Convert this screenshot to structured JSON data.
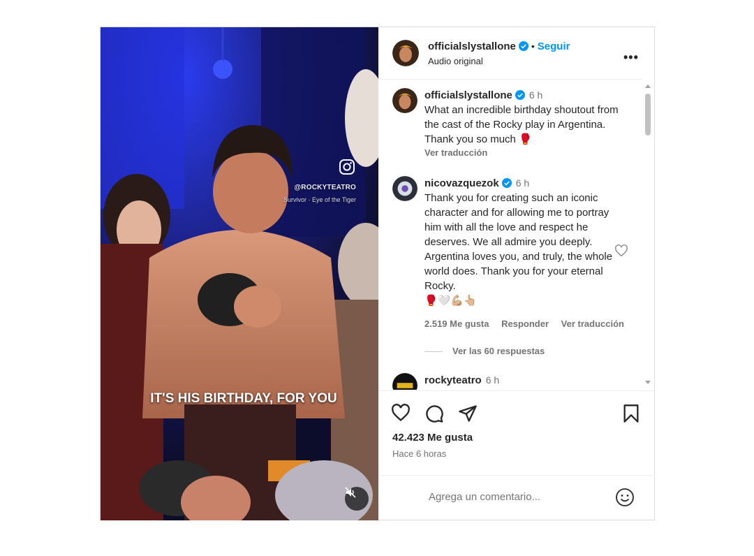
{
  "media": {
    "handle": "@ROCKYTEATRO",
    "song": "Survivor · Eye of the Tiger",
    "caption": "IT'S HIS BIRTHDAY, FOR YOU",
    "icons": [
      "instagram-icon",
      "mute-icon"
    ]
  },
  "header": {
    "username": "officialslystallone",
    "separator": "•",
    "follow_label": "Seguir",
    "audio": "Audio original",
    "more_label": "•••"
  },
  "comments": [
    {
      "username": "officialslystallone",
      "time": "6 h",
      "text": "What an incredible birthday shoutout from the cast of the Rocky play in Argentina. Thank you so much 🥊",
      "translate": "Ver traducción"
    },
    {
      "username": "nicovazquezok",
      "time": "6 h",
      "text": "Thank you for creating such an iconic character and for allowing me to portray him with all the love and respect he deserves. We all admire you deeply. Argentina loves you, and truly, the whole world does. Thank you for your eternal Rocky.",
      "emojis": "🥊🤍💪🏼👆🏼",
      "likes": "2.519 Me gusta",
      "reply": "Responder",
      "translate": "Ver traducción",
      "view_replies": "Ver las 60 respuestas"
    },
    {
      "username": "rockyteatro",
      "time": "6 h"
    }
  ],
  "actions": {
    "likes": "42.423 Me gusta",
    "time_ago": "Hace 6 horas",
    "comment_placeholder": "Agrega un comentario..."
  },
  "colors": {
    "accent": "#0095f6",
    "verified": "#0095f6",
    "text": "#262626",
    "muted": "#737373"
  }
}
